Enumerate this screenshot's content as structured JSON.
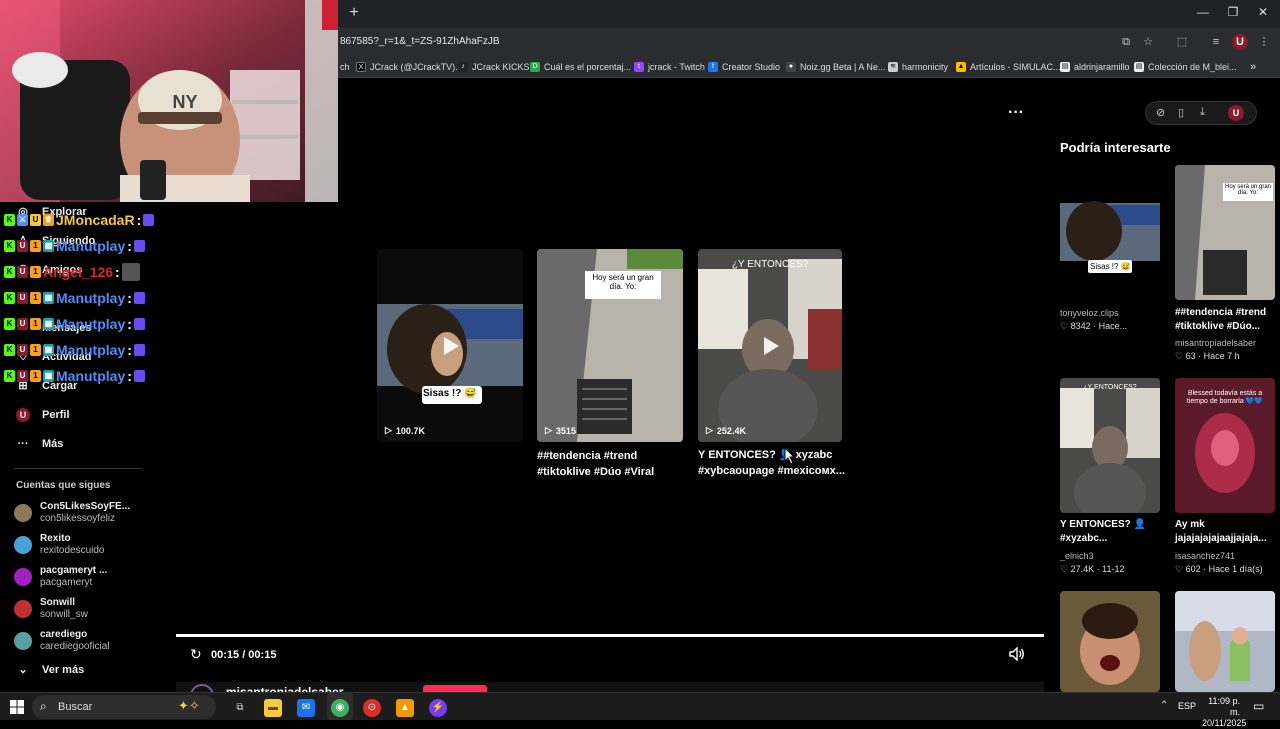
{
  "browser": {
    "new_tab": "+",
    "url": "867585?_r=1&_t=ZS-91ZhAhaFzJB",
    "bookmarks": [
      {
        "label": "ch",
        "icon": ""
      },
      {
        "label": "JCrack (@JCrackTV)...",
        "icon": "x-icon"
      },
      {
        "label": "JCrack KICKS",
        "icon": "tiktok-icon"
      },
      {
        "label": "Cuál es el porcentaj...",
        "icon": "d-icon"
      },
      {
        "label": "jcrack - Twitch",
        "icon": "twitch-icon"
      },
      {
        "label": "Creator Studio",
        "icon": "facebook-icon"
      },
      {
        "label": "Noiz.gg Beta | A Ne...",
        "icon": "noiz-icon"
      },
      {
        "label": "harmonicity",
        "icon": "harmonicity-icon"
      },
      {
        "label": "Artículos - SIMULAC...",
        "icon": "drive-icon"
      },
      {
        "label": "aldrinjaramillo",
        "icon": "doc-icon"
      },
      {
        "label": "Colección de M_blei...",
        "icon": "doc-icon"
      }
    ]
  },
  "chat": [
    {
      "user": "JMoncadaR",
      "sep": ":",
      "color": "#f7c842"
    },
    {
      "user": "Manutplay",
      "sep": ":",
      "color": "#4f8ef7"
    },
    {
      "user": "Angel_126",
      "sep": ":",
      "color": "#d9262e"
    },
    {
      "user": "Manutplay",
      "sep": ":",
      "color": "#4f8ef7"
    },
    {
      "user": "Manutplay",
      "sep": ":",
      "color": "#4f8ef7"
    },
    {
      "user": "Manutplay",
      "sep": ":",
      "color": "#4f8ef7"
    },
    {
      "user": "Manutplay",
      "sep": ":",
      "color": "#4f8ef7"
    }
  ],
  "sidebar": {
    "nav": [
      "Explorar",
      "Siguiendo",
      "Amigos",
      "Mensajes",
      "Actividad",
      "Cargar",
      "Perfil",
      "Más"
    ],
    "following_title": "Cuentas que sigues",
    "following": [
      {
        "name": "Con5LikesSoyFE...",
        "handle": "con5likessoyfeliz",
        "color": "#8a7a5a"
      },
      {
        "name": "Rexito",
        "handle": "rexitodescuido",
        "color": "#4aa3d8"
      },
      {
        "name": "pacgameryt ...",
        "handle": "pacgameryt",
        "color": "#a020c0"
      },
      {
        "name": "Sonwill",
        "handle": "sonwill_sw",
        "color": "#c03030"
      },
      {
        "name": "carediego",
        "handle": "carediegooficial",
        "color": "#5aa0a0"
      }
    ],
    "see_more": "Ver más"
  },
  "player": {
    "time": "00:15 / 00:15",
    "more": "···",
    "author": "misantropiadelsaber",
    "cards": [
      {
        "views": "100.7K",
        "caption_lines": [],
        "overlay": "Sisas !? 😅"
      },
      {
        "views": "3515",
        "caption_lines": [
          "##tendencia #trend",
          "#tiktoklive #Dúo #Viral"
        ],
        "overlay": "Hoy será un gran día. Yo:"
      },
      {
        "views": "252.4K",
        "caption_lines": [
          "Y ENTONCES? 👤 xyzabc",
          "#xybcaoupage #mexicoмх..."
        ],
        "overlay": "¿Y ENTONCES?"
      }
    ]
  },
  "recommend": {
    "title": "Podría interesarte",
    "items": [
      {
        "title": "",
        "title2": "",
        "user": "tonyveloz.clips",
        "likes": "8342",
        "when": "Hace...",
        "overlay": "Sisas !? 😅"
      },
      {
        "title": "##tendencia #trend",
        "title2": "#tiktoklive #Dúo...",
        "user": "misantropiadelsaber",
        "likes": "63",
        "when": "Hace 7 h",
        "overlay": "Hoy será un gran día. Yo:"
      },
      {
        "title": "Y ENTONCES? 👤",
        "title2": "#xyzabc...",
        "user": "_elnich3",
        "likes": "27.4K",
        "when": "11-12",
        "overlay": "¿Y ENTONCES?"
      },
      {
        "title": "Ay mk",
        "title2": "jajajajajajaajjajaja...",
        "user": "isasanchez741",
        "likes": "602",
        "when": "Hace 1 día(s)",
        "overlay": "Blessed todavía estás a tiempo de borrarla 💙💙"
      }
    ]
  },
  "taskbar": {
    "search": "Buscar",
    "lang": "ESP",
    "time": "11:09 p. m.",
    "date": "20/11/2025"
  },
  "colors": {
    "accent": "#fe2c55",
    "chrome": "#202124"
  }
}
